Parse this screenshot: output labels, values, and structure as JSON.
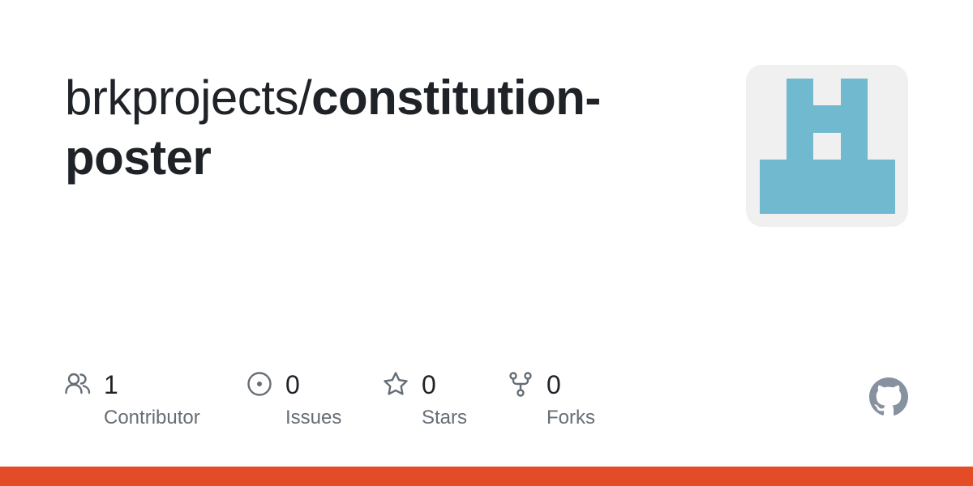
{
  "repo": {
    "owner": "brkprojects/",
    "name": "constitution-poster"
  },
  "stats": {
    "contributors": {
      "count": "1",
      "label": "Contributor",
      "icon": "people-icon"
    },
    "issues": {
      "count": "0",
      "label": "Issues",
      "icon": "issue-opened-icon"
    },
    "stars": {
      "count": "0",
      "label": "Stars",
      "icon": "star-icon"
    },
    "forks": {
      "count": "0",
      "label": "Forks",
      "icon": "repo-forked-icon"
    }
  },
  "colors": {
    "avatar_background": "#f0f0f0",
    "avatar_pattern": "#71b9cf",
    "icon_gray": "#656d76",
    "logo_gray": "#8791a0",
    "language_bar": "#e34c26"
  }
}
